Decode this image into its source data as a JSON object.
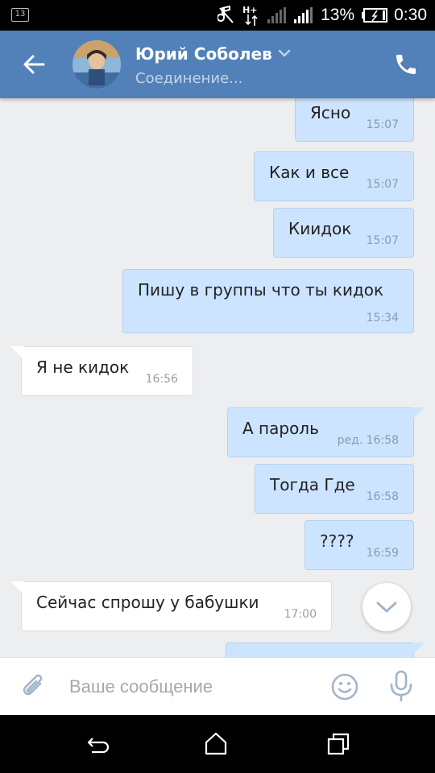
{
  "status_bar": {
    "notification_count": "13",
    "network_type": "H+",
    "battery_percent": "13%",
    "time": "0:30"
  },
  "header": {
    "contact_name": "Юрий Соболев",
    "connection_status": "Соединение..."
  },
  "messages": [
    {
      "direction": "out",
      "text": "Ясно",
      "time": "15:07"
    },
    {
      "direction": "out",
      "text": "Как и все",
      "time": "15:07"
    },
    {
      "direction": "out",
      "text": "Киидок",
      "time": "15:07"
    },
    {
      "direction": "out",
      "text": "Пишу в группы что ты кидок",
      "time": "15:34"
    },
    {
      "direction": "in",
      "text": "Я не кидок",
      "time": "16:56"
    },
    {
      "direction": "out",
      "text": "А пароль",
      "time": "ред. 16:58"
    },
    {
      "direction": "out",
      "text": "Тогда Где",
      "time": "16:58"
    },
    {
      "direction": "out",
      "text": "????",
      "time": "16:59"
    },
    {
      "direction": "in",
      "text": "Сейчас спрошу у бабушки",
      "time": "17:00"
    }
  ],
  "composer": {
    "placeholder": "Ваше сообщение"
  },
  "colors": {
    "header_bg": "#5181b8",
    "outgoing_bubble": "#cce4ff",
    "incoming_bubble": "#ffffff",
    "chat_bg": "#edeef0",
    "accent_icon": "#a3b5c9"
  },
  "icons": {
    "back": "arrow-left-icon",
    "call": "phone-icon",
    "attach": "paperclip-icon",
    "emoji": "smiley-icon",
    "mic": "microphone-icon",
    "scroll_down": "chevron-down-icon"
  }
}
